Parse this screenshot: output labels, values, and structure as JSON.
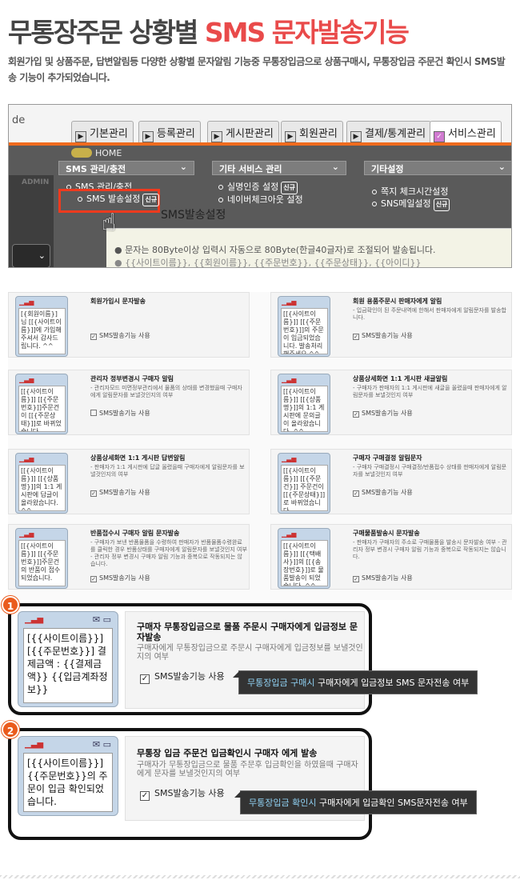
{
  "header": {
    "title_part1": "무통장주문 상황별",
    "title_part2": "SMS 문자발송기능",
    "description": "회원가입 및 상품주문, 답변알림등 다양한 상황별 문자알림 기능중 무통장입금으로 상품구매시, 무통장입금 주문건 확인시 SMS발송 기능이 추가되었습니다.",
    "accent_color": "#e94a4a"
  },
  "admin": {
    "brand": "de",
    "tabs": [
      "기본관리",
      "등록관리",
      "게시판관리",
      "회원관리",
      "결제/통계관리",
      "서비스관리"
    ],
    "breadcrumb": "HOME",
    "menus": [
      {
        "title": "SMS 관리/충전",
        "items": [
          "SMS 관리/충전",
          "SMS 발송설정"
        ]
      },
      {
        "title": "기타 서비스 관리",
        "items": [
          "실명인증 설정",
          "네이버체크아웃 설정"
        ]
      },
      {
        "title": "기타설정",
        "items": [
          "쪽지 체크시간설정",
          "SNS메일설정"
        ]
      }
    ],
    "new_badge": "신규",
    "admin_label": "ADMIN",
    "ghost_title": "SMS발송설정",
    "bullet1": "문자는 80Byte이상 입력시 자동으로 80Byte(한글40글자)로 조절되어 발송됩니다.",
    "bullet2": "{{사이트이름}}, {{회원이름}}, {{주문번호}}, {{주문상태}}, {{아이디}}"
  },
  "cards": [
    {
      "msg": "[{회원이름}]님 [[{사이트이름}]]에 가입해주셔서 감사드립니다. ^^",
      "title": "회원가입시 문자발송",
      "desc": "",
      "check": "SMS발송기능 사용",
      "checked": true
    },
    {
      "msg": "[[{사이트이름}]] [[{주문번호}]]의 주문이 입금되었습니다. 발송처리해주세요 ^^",
      "title": "회원 용품주문시 판매자에게 알림",
      "desc": "- 입금확인이 된 주문내역에 한해서 판매자에게 알림문자를 발송합니다.",
      "check": "SMS발송기능 사용",
      "checked": true
    },
    {
      "msg": "[[{사이트이름}]] [[{주문번호}]]주문건이 [[{주문상태}]]로 바뀌었습니다",
      "title": "관리자 정부변경시 구매자 알림",
      "desc": "- 관리자모드 미면정부관리에서 물품의 상태를 변경했을때 구매자에게 알림문자를 보낼것인지의 여부",
      "check": "SMS발송기능 사용",
      "checked": false
    },
    {
      "msg": "[[{사이트이름}]] [[{상품명}]]의 1:1 게시판에 문의글이 올라왔습니다. ^^",
      "title": "상품상세화면 1:1 게시판 새글알림",
      "desc": "- 구매자가 판매자의 1:1 게시판에 새글을 올렸을때 판매자에게 알림문자를 보낼것인지 여부",
      "check": "SMS발송기능 사용",
      "checked": true
    },
    {
      "msg": "[[{사이트이름}]] [[{상품명}]]의 1:1 게시판에 답글이 올라왔습니다. ^^",
      "title": "상품상세화면 1:1 게시판 답변알림",
      "desc": "- 판매자가 1:1 게시판에 답글 올렸을때 구매자에게 알림문자를 보낼것인지의 여부",
      "check": "SMS발송기능 사용",
      "checked": true
    },
    {
      "msg": "[[{사이트이름}]] [[{주문건}]] 주문건이 [[{주문상태}]]로 바뀌었습니다.",
      "title": "구매자 구매결정 알림문자",
      "desc": "- 구매자 구매결정시 구매결정/반품접수 상태를 판매자에게 알림문자를 보낼것인지 여부",
      "check": "SMS발송기능 사용",
      "checked": true
    },
    {
      "msg": "[[{사이트이름}]] [[{주문번호}]]주문건의 반품이 접수되었습니다.",
      "title": "반품접수시 구매자 알림 문자발송",
      "desc": "- 구매자가 보낸 반품물품을 수령하여 판매자가 반품물품수령완료를 클릭한 경우 반품상태를 구매자에게 알림문자를 보낼것인지 여부 - 관리자 정부 변경시 구매자 알림 기능과 중복으로 작동되지는 않습니다.",
      "check": "SMS발송기능 사용",
      "checked": true
    },
    {
      "msg": "[[{사이트이름}]] [[{택배사}]]의 [[{송장번호}]]로 물품발송이 되었습니다. ^^",
      "title": "구매물품발송시 문자발송",
      "desc": "- 판매자가 구매자의 주소로 구매물품을 발송시 문자발송 여부 - 관리자 정부 변경시 구매자 알림 기능과 중복으로 작동되지는 않습니다.",
      "check": "SMS발송기능 사용",
      "checked": true
    }
  ],
  "highlights": [
    {
      "number": "1",
      "phone_msg": "[{{사이트이름}}] [{{주문번호}}] 결제금액 : {{결제금액}} {{입금계좌정보}}",
      "title": "구매자 무통장입금으로 물품 주문시 구매자에게 입금정보 문자발송",
      "desc": "구매자에게 무통장입금으로 주문시 구매자에게 입금정보를 보낼것인지의 여부",
      "check": "SMS발송기능 사용",
      "tip_highlight": "무통장입금 구매시",
      "tip_rest": "구매자에게 입금정보 SMS 문자전송 여부"
    },
    {
      "number": "2",
      "phone_msg": "[{{사이트이름}}] {{주문번호}}의 주문이 입금 확인되었습니다.",
      "title": "무통장 입금 주문건 입금확인시 구매자 에게 발송",
      "desc": "구매자가 무통장입금으로 물품 주문후 입금확인을 하였을때 구매자에게 문자를 보낼것인지의 여부",
      "check": "SMS발송기능 사용",
      "tip_highlight": "무통장입금 확인시",
      "tip_rest": "구매자에게 입금확인 SMS문자전송 여부"
    }
  ],
  "icons": {
    "signal": "signal-icon",
    "mail": "mail-icon",
    "battery": "battery-icon"
  }
}
